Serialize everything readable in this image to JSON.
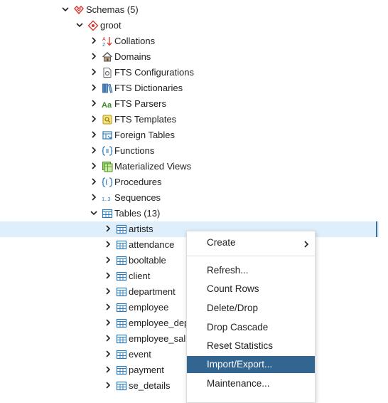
{
  "tree": {
    "schemas_label": "Schemas (5)",
    "schema_name": "groot",
    "nodes": [
      {
        "label": "Collations",
        "icon": "collation-icon"
      },
      {
        "label": "Domains",
        "icon": "domain-icon"
      },
      {
        "label": "FTS Configurations",
        "icon": "fts-configuration-icon"
      },
      {
        "label": "FTS Dictionaries",
        "icon": "fts-dictionary-icon"
      },
      {
        "label": "FTS Parsers",
        "icon": "fts-parser-icon"
      },
      {
        "label": "FTS Templates",
        "icon": "fts-template-icon"
      },
      {
        "label": "Foreign Tables",
        "icon": "foreign-table-icon"
      },
      {
        "label": "Functions",
        "icon": "function-icon"
      },
      {
        "label": "Materialized Views",
        "icon": "materialized-view-icon"
      },
      {
        "label": "Procedures",
        "icon": "procedure-icon"
      },
      {
        "label": "Sequences",
        "icon": "sequence-icon"
      }
    ],
    "tables_label": "Tables (13)",
    "tables": [
      "artists",
      "attendance",
      "booltable",
      "client",
      "department",
      "employee",
      "employee_dep",
      "employee_sal",
      "event",
      "payment",
      "se_details"
    ],
    "selected_table": "artists"
  },
  "context_menu": {
    "items": [
      {
        "label": "Create",
        "has_submenu": true
      },
      {
        "label": "Refresh..."
      },
      {
        "label": "Count Rows"
      },
      {
        "label": "Delete/Drop"
      },
      {
        "label": "Drop Cascade"
      },
      {
        "label": "Reset Statistics"
      },
      {
        "label": "Import/Export...",
        "active": true
      },
      {
        "label": "Maintenance..."
      }
    ]
  },
  "colors": {
    "selection_bg": "#deeefa",
    "menu_active_bg": "#326690",
    "table_icon": "#2d7ab8",
    "schema_icon": "#d9342b"
  }
}
